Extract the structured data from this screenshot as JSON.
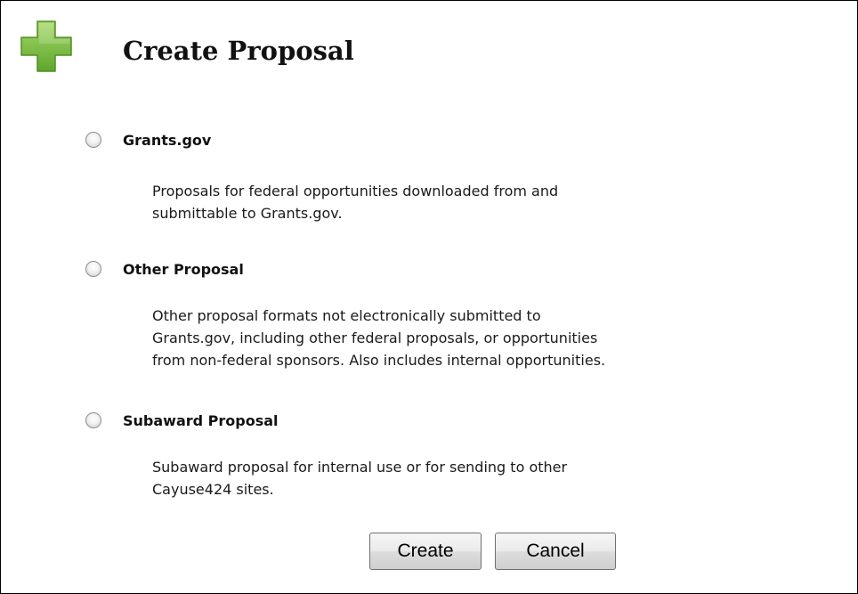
{
  "dialog": {
    "title": "Create Proposal",
    "icon": "plus-icon",
    "icon_color": "#7bc043"
  },
  "options": [
    {
      "label": "Grants.gov",
      "selected": false,
      "description_lines": [
        "Proposals for federal opportunities downloaded from and",
        "submittable to Grants.gov."
      ]
    },
    {
      "label": "Other Proposal",
      "selected": false,
      "description_lines": [
        "Other proposal formats not electronically submitted to",
        "Grants.gov, including other federal proposals, or opportunities",
        "from non-federal sponsors. Also includes internal opportunities."
      ]
    },
    {
      "label": "Subaward Proposal",
      "selected": false,
      "description_lines": [
        "Subaward proposal for internal use or for sending to other",
        "Cayuse424 sites."
      ]
    }
  ],
  "buttons": {
    "create_label": "Create",
    "cancel_label": "Cancel"
  }
}
